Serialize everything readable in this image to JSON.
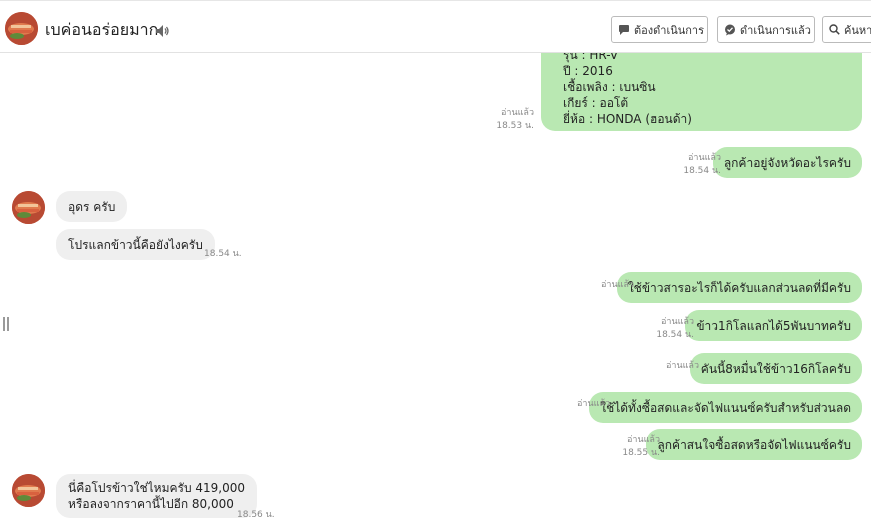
{
  "header": {
    "contact_name": "เบค่อนอร่อยมาก",
    "speaker_icon": "speaker-icon",
    "buttons": {
      "todo": "ต้องดำเนินการ",
      "done": "ดำเนินการแล้ว",
      "search": "ค้นหา"
    }
  },
  "car_card": {
    "lines": [
      "รุ่น : HR-V",
      "ปี : 2016",
      "เชื้อเพลิง : เบนซิน",
      "เกียร์ : ออโต้",
      "ยี่ห้อ : HONDA (ฮอนด้า)"
    ],
    "read_label": "อ่านแล้ว",
    "time": "18.53 น."
  },
  "messages": [
    {
      "id": "m1",
      "direction": "out",
      "text": "ลูกค้าอยู่จังหวัดอะไรครับ",
      "read_label": "อ่านแล้ว",
      "time": "18.54 น."
    },
    {
      "id": "m2",
      "direction": "in",
      "text": "อุดร ครับ",
      "time": ""
    },
    {
      "id": "m3",
      "direction": "in",
      "text": "โปรแลกข้าวนี้คือยังไงครับ",
      "time": "18.54 น."
    },
    {
      "id": "m4",
      "direction": "out",
      "text": "ใช้ข้าวสารอะไรก็ได้ครับแลกส่วนลดที่มีครับ",
      "read_label": "อ่านแล้ว",
      "time": ""
    },
    {
      "id": "m5",
      "direction": "out",
      "text": "ข้าว1กิโลแลกได้5พันบาทครับ",
      "read_label": "อ่านแล้ว",
      "time": "18.54 น."
    },
    {
      "id": "m6",
      "direction": "out",
      "text": "คันนี้8หมื่นใช้ข้าว16กิโลครับ",
      "read_label": "อ่านแล้ว",
      "time": ""
    },
    {
      "id": "m7",
      "direction": "out",
      "text": "ใช้ได้ทั้งซื้อสดและจัดไฟแนนซ์ครับสำหรับส่วนลด",
      "read_label": "อ่านแล้ว",
      "time": ""
    },
    {
      "id": "m8",
      "direction": "out",
      "text": "ลูกค้าสนใจซื้อสดหรือจัดไฟแนนซ์ครับ",
      "read_label": "อ่านแล้ว",
      "time": "18.55 น."
    },
    {
      "id": "m9",
      "direction": "in",
      "lines": [
        "นี่คือโปรข้าวใช่ไหมครับ 419,000",
        "หรือลงจากราคานี้ไปอีก 80,000"
      ],
      "time": "18.56 น."
    }
  ],
  "colors": {
    "outgoing_bubble": "#b9e8b2",
    "incoming_bubble": "#efefef",
    "meta_text": "#888888"
  }
}
